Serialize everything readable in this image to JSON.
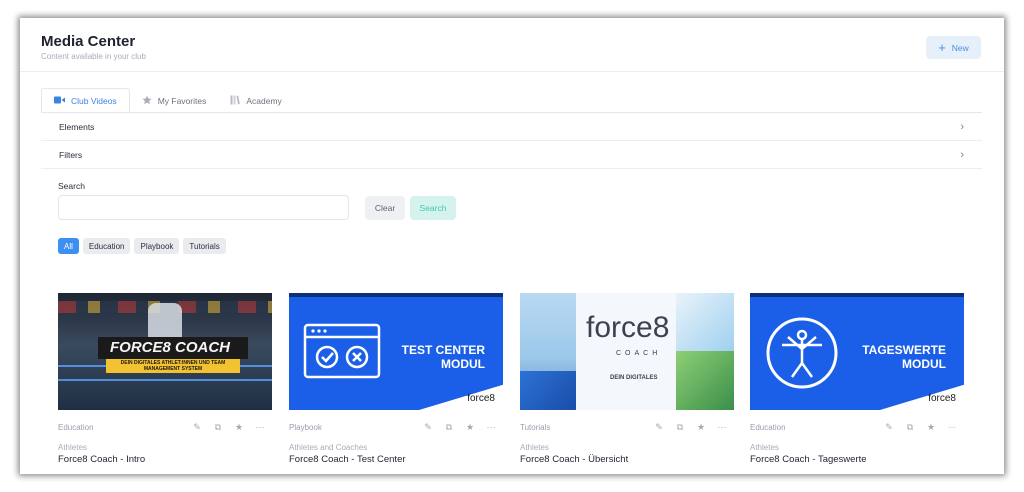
{
  "header": {
    "title": "Media Center",
    "subtitle": "Content available in your club",
    "new_label": "New"
  },
  "tabs": [
    {
      "label": "Club Videos",
      "icon": "video-camera-icon",
      "active": true
    },
    {
      "label": "My Favorites",
      "icon": "star-icon",
      "active": false
    },
    {
      "label": "Academy",
      "icon": "book-icon",
      "active": false
    }
  ],
  "accordions": [
    {
      "label": "Elements"
    },
    {
      "label": "Filters"
    }
  ],
  "search": {
    "label": "Search",
    "placeholder": "",
    "value": "",
    "clear_label": "Clear",
    "search_label": "Search"
  },
  "chips": [
    {
      "label": "All",
      "active": true
    },
    {
      "label": "Education",
      "active": false
    },
    {
      "label": "Playbook",
      "active": false
    },
    {
      "label": "Tutorials",
      "active": false
    }
  ],
  "videos": [
    {
      "category": "Education",
      "audience": "Athletes",
      "title": "Force8 Coach - Intro",
      "thumb_line1": "FORCE8 COACH",
      "thumb_line2": "DEIN DIGITALES ATHLET:INNEN UND TEAM MANAGEMENT SYSTEM"
    },
    {
      "category": "Playbook",
      "audience": "Athletes and Coaches",
      "title": "Force8 Coach - Test Center",
      "thumb_line1": "TEST CENTER",
      "thumb_line2": "MODUL",
      "thumb_logo": "force8"
    },
    {
      "category": "Tutorials",
      "audience": "Athletes",
      "title": "Force8 Coach - Übersicht",
      "thumb_line1": "force8",
      "thumb_line2": "COACH",
      "thumb_line3": "DEIN DIGITALES"
    },
    {
      "category": "Education",
      "audience": "Athletes",
      "title": "Force8 Coach - Tageswerte",
      "thumb_line1": "TAGESWERTE",
      "thumb_line2": "MODUL",
      "thumb_logo": "force8"
    }
  ],
  "colors": {
    "accent": "#3d8ff0",
    "search_btn_bg": "#d4f3ef",
    "search_btn_text": "#43c7b7",
    "thumb_blue": "#1b5fe8"
  }
}
